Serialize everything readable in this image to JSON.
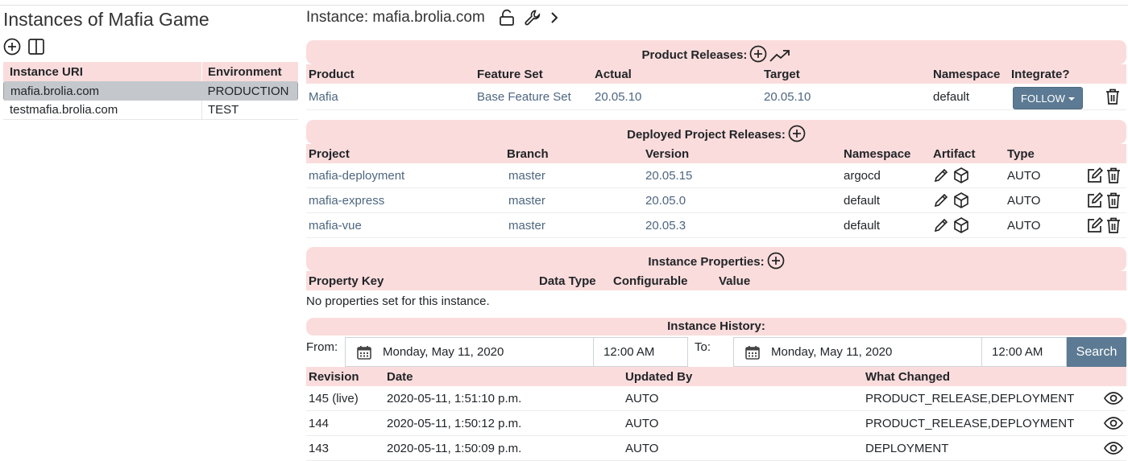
{
  "left": {
    "title": "Instances of Mafia Game",
    "table": {
      "headers": [
        "Instance URI",
        "Environment"
      ],
      "rows": [
        {
          "uri": "mafia.brolia.com",
          "env": "PRODUCTION",
          "selected": true
        },
        {
          "uri": "testmafia.brolia.com",
          "env": "TEST",
          "selected": false
        }
      ]
    }
  },
  "instance": {
    "title": "Instance: mafia.brolia.com"
  },
  "product_releases": {
    "title": "Product Releases:",
    "headers": [
      "Product",
      "Feature Set",
      "Actual",
      "Target",
      "Namespace",
      "Integrate?"
    ],
    "rows": [
      {
        "product": "Mafia",
        "feature_set": "Base Feature Set",
        "actual": "20.05.10",
        "target": "20.05.10",
        "namespace": "default",
        "integrate": "FOLLOW"
      }
    ]
  },
  "deployed_releases": {
    "title": "Deployed Project Releases:",
    "headers": [
      "Project",
      "Branch",
      "Version",
      "Namespace",
      "Artifact",
      "Type"
    ],
    "rows": [
      {
        "project": "mafia-deployment",
        "branch": "master",
        "version": "20.05.15",
        "namespace": "argocd",
        "type": "AUTO"
      },
      {
        "project": "mafia-express",
        "branch": "master",
        "version": "20.05.0",
        "namespace": "default",
        "type": "AUTO"
      },
      {
        "project": "mafia-vue",
        "branch": "master",
        "version": "20.05.3",
        "namespace": "default",
        "type": "AUTO"
      }
    ]
  },
  "instance_properties": {
    "title": "Instance Properties:",
    "headers": [
      "Property Key",
      "Data Type",
      "Configurable",
      "Value"
    ],
    "empty_text": "No properties set for this instance."
  },
  "history": {
    "title": "Instance History:",
    "from_label": "From:",
    "to_label": "To:",
    "from_date": "Monday, May 11, 2020",
    "from_time": "12:00 AM",
    "to_date": "Monday, May 11, 2020",
    "to_time": "12:00 AM",
    "search_label": "Search",
    "headers": [
      "Revision",
      "Date",
      "Updated By",
      "What Changed"
    ],
    "rows": [
      {
        "revision": "145 (live)",
        "date": "2020-05-11, 1:51:10 p.m.",
        "updated_by": "AUTO",
        "changed": "PRODUCT_RELEASE,DEPLOYMENT"
      },
      {
        "revision": "144",
        "date": "2020-05-11, 1:50:12 p.m.",
        "updated_by": "AUTO",
        "changed": "PRODUCT_RELEASE,DEPLOYMENT"
      },
      {
        "revision": "143",
        "date": "2020-05-11, 1:50:09 p.m.",
        "updated_by": "AUTO",
        "changed": "DEPLOYMENT"
      }
    ]
  },
  "icons": {
    "add": "plus-circle-icon",
    "columns": "columns-icon",
    "lock": "unlock-icon",
    "settings": "wrench-icon",
    "next": "chevron-right-icon",
    "upgrade": "trending-up-icon",
    "delete": "trash-icon",
    "edit": "edit-icon",
    "artifact": "package-icon",
    "view": "eye-icon",
    "calendar": "calendar-icon"
  },
  "colors": {
    "header_bg": "#fbdcdc",
    "button": "#5c7a93",
    "selected_row": "#c4c8cd",
    "link": "#4d6680"
  }
}
